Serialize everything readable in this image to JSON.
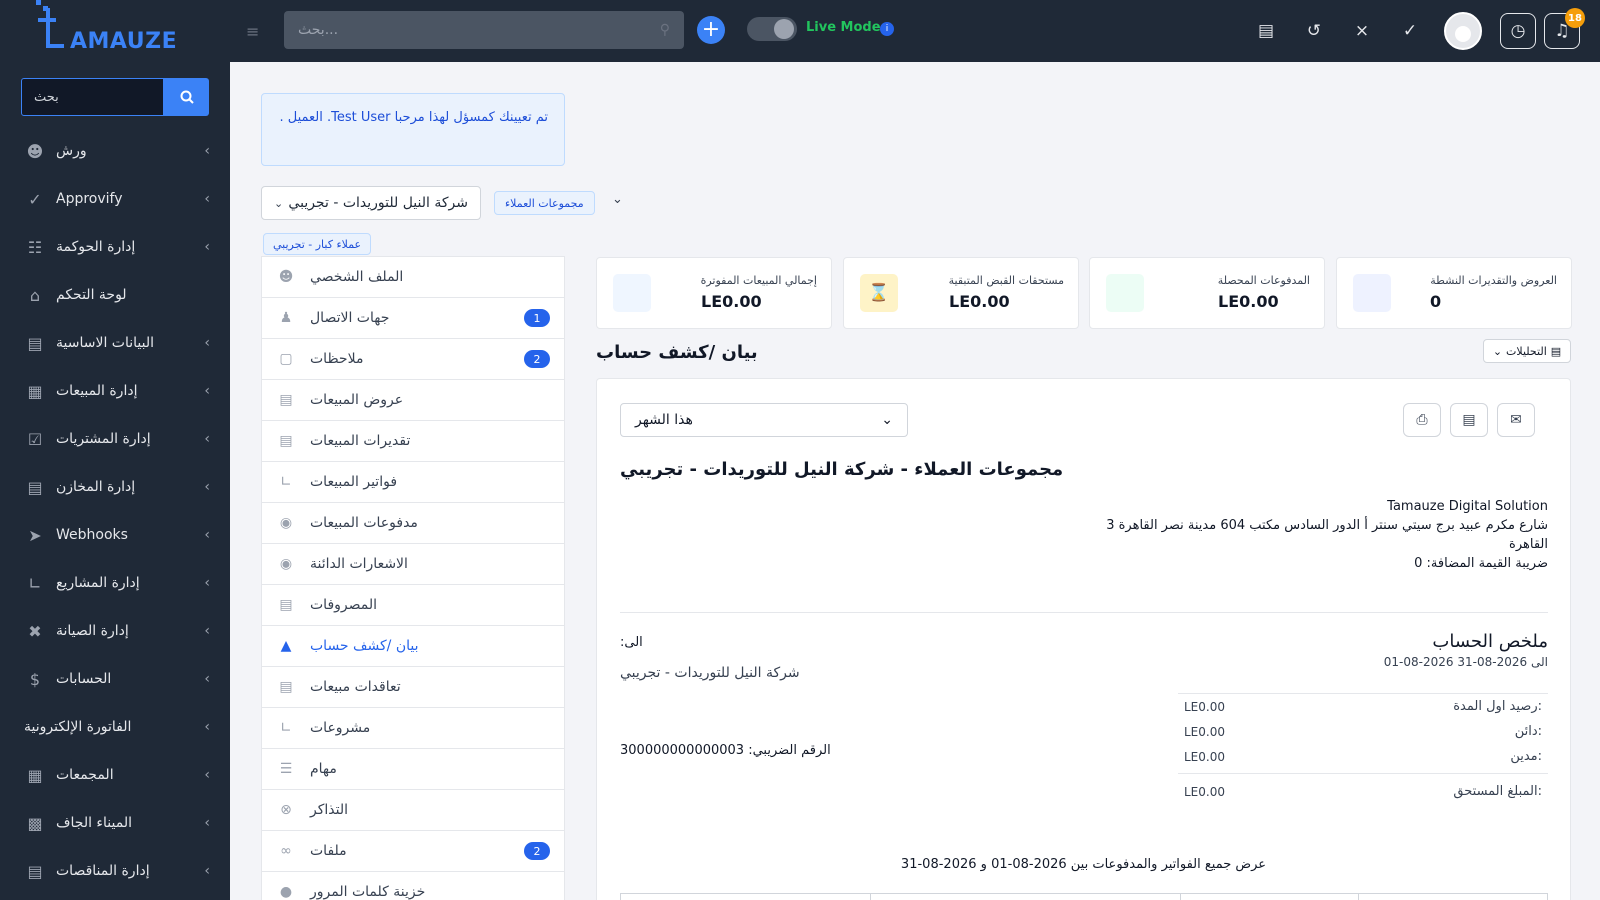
{
  "brand": {
    "logo_text": "AMAUZE",
    "accent": "#3b82f6"
  },
  "sidebar": {
    "search_placeholder": "بحث",
    "items": [
      {
        "label": "ورش",
        "icon": "team-icon",
        "has_children": true
      },
      {
        "label": "Approvify",
        "icon": "check-icon",
        "has_children": true
      },
      {
        "label": "إدارة الحوكمة",
        "icon": "hierarchy-icon",
        "has_children": true
      },
      {
        "label": "لوحة التحكم",
        "icon": "home-icon",
        "has_children": false
      },
      {
        "label": "البيانات الاساسية",
        "icon": "bank-icon",
        "has_children": true
      },
      {
        "label": "إدارة المبيعات",
        "icon": "store-icon",
        "has_children": true
      },
      {
        "label": "إدارة المشتريات",
        "icon": "cart-icon",
        "has_children": true
      },
      {
        "label": "إدارة المخازن",
        "icon": "warehouse-icon",
        "has_children": true
      },
      {
        "label": "Webhooks",
        "icon": "send-icon",
        "has_children": true
      },
      {
        "label": "إدارة المشاريع",
        "icon": "chart-icon",
        "has_children": true
      },
      {
        "label": "إدارة الصيانة",
        "icon": "tools-icon",
        "has_children": true
      },
      {
        "label": "الحسابات",
        "icon": "dollar-icon",
        "has_children": true
      },
      {
        "label": "الفاتورة الإلكترونية",
        "icon": "",
        "has_children": true
      },
      {
        "label": "المجمعات",
        "icon": "building-icon",
        "has_children": true
      },
      {
        "label": "الميناء الجاف",
        "icon": "truck-icon",
        "has_children": true
      },
      {
        "label": "إدارة المناقصات",
        "icon": "document-icon",
        "has_children": true
      }
    ]
  },
  "topbar": {
    "search_placeholder": "بحث...",
    "live_mode_label": "Live Mode",
    "notification_count": "18"
  },
  "welcome_message": "تم تعيينك كمسؤل لهذا مرحبا Test User. العميل .",
  "customer": {
    "name": "شركة النيل للتوريدات - تجريبي",
    "group_tag": "مجموعات العملاء",
    "tier_tag": "عملاء كبار - تجريبي"
  },
  "tabs": [
    {
      "label": "الملف الشخصي",
      "icon": "user-circle-icon",
      "badge": "",
      "active": false
    },
    {
      "label": "جهات الاتصال",
      "icon": "user-icon",
      "badge": "1",
      "active": false
    },
    {
      "label": "ملاحظات",
      "icon": "note-icon",
      "badge": "2",
      "active": false
    },
    {
      "label": "عروض المبيعات",
      "icon": "file-icon",
      "badge": "",
      "active": false
    },
    {
      "label": "تقديرات المبيعات",
      "icon": "file-icon",
      "badge": "",
      "active": false
    },
    {
      "label": "فواتير المبيعات",
      "icon": "line-chart-icon",
      "badge": "",
      "active": false
    },
    {
      "label": "مدفوعات المبيعات",
      "icon": "money-bag-icon",
      "badge": "",
      "active": false
    },
    {
      "label": "الاشعارات الدائنة",
      "icon": "money-bag-icon",
      "badge": "",
      "active": false
    },
    {
      "label": "المصروفات",
      "icon": "file-text-icon",
      "badge": "",
      "active": false
    },
    {
      "label": "بيان /كشف حساب",
      "icon": "area-chart-icon",
      "badge": "",
      "active": true
    },
    {
      "label": "تعاقدات مبيعات",
      "icon": "contract-icon",
      "badge": "",
      "active": false
    },
    {
      "label": "مشروعات",
      "icon": "chart-icon",
      "badge": "",
      "active": false
    },
    {
      "label": "مهام",
      "icon": "checklist-icon",
      "badge": "",
      "active": false
    },
    {
      "label": "التذاكر",
      "icon": "lifebuoy-icon",
      "badge": "",
      "active": false
    },
    {
      "label": "ملفات",
      "icon": "paperclip-icon",
      "badge": "2",
      "active": false
    },
    {
      "label": "خزينة كلمات المرور",
      "icon": "lock-icon",
      "badge": "",
      "active": false
    }
  ],
  "stats": [
    {
      "title": "إجمالي المبيعات المفوترة",
      "value": "LE0.00",
      "color": "#eff6ff",
      "icon": ""
    },
    {
      "title": "مستحقات القبض المتبقية",
      "value": "LE0.00",
      "color": "#fef3c7",
      "icon": "hourglass-icon"
    },
    {
      "title": "المدفوعات المحصلة",
      "value": "LE0.00",
      "color": "#ecfdf5",
      "icon": ""
    },
    {
      "title": "العروض والتقديرات النشطة",
      "value": "0",
      "color": "#eef2ff",
      "icon": ""
    }
  ],
  "statement": {
    "section_title": "بيان /كشف حساب",
    "analytics_label": "التحليلات",
    "period": "هذا الشهر",
    "heading": "مجموعات العملاء - شركة النيل للتوريدات - تجريبي",
    "company_name": "Tamauze Digital Solution",
    "company_address_1": "شارع مكرم عبيد برج سيتي سنتر أ الدور السادس مكتب 604 مدينة نصر القاهرة 3",
    "company_address_2": "القاهرة",
    "company_vat": "ضريبة القيمة المضافة: 0",
    "summary_title": "ملخص الحساب",
    "summary_range": "الى 2026-08-31 2026-08-01",
    "to_label": ":الى",
    "to_name": "شركة النيل للتوريدات - تجريبي",
    "tax_number": "الرقم الضريبي: 300000000000003",
    "rows": [
      {
        "label": ":رصيد اول المدة",
        "value": "LE0.00"
      },
      {
        "label": ":دائن",
        "value": "LE0.00"
      },
      {
        "label": ":مدين",
        "value": "LE0.00"
      }
    ],
    "total_label": ":المبلغ المستحق",
    "total_value": "LE0.00",
    "display_note": "عرض جميع الفواتير والمدفوعات بين 2026-08-01 و 2026-08-31"
  }
}
